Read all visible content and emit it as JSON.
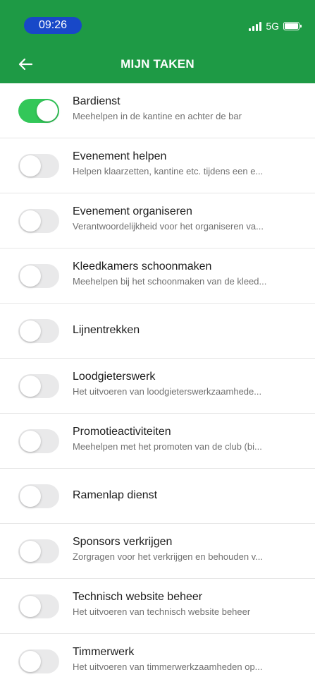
{
  "status_bar": {
    "time": "09:26",
    "network": "5G"
  },
  "nav": {
    "title": "MIJN TAKEN"
  },
  "colors": {
    "header": "#1e9a45",
    "toggle_on": "#33c759",
    "toggle_off": "#e9e9ea",
    "time_pill": "#1848c8"
  },
  "tasks": [
    {
      "title": "Bardienst",
      "desc": "Meehelpen in de kantine en achter de bar",
      "on": true
    },
    {
      "title": "Evenement helpen",
      "desc": "Helpen klaarzetten, kantine etc. tijdens een e...",
      "on": false
    },
    {
      "title": "Evenement organiseren",
      "desc": "Verantwoordelijkheid voor het organiseren va...",
      "on": false
    },
    {
      "title": "Kleedkamers schoonmaken",
      "desc": "Meehelpen bij het schoonmaken van de kleed...",
      "on": false
    },
    {
      "title": "Lijnentrekken",
      "desc": "",
      "on": false
    },
    {
      "title": "Loodgieterswerk",
      "desc": "Het uitvoeren van loodgieterswerkzaamhede...",
      "on": false
    },
    {
      "title": "Promotieactiviteiten",
      "desc": "Meehelpen met het promoten van de club (bi...",
      "on": false
    },
    {
      "title": "Ramenlap dienst",
      "desc": "",
      "on": false
    },
    {
      "title": "Sponsors verkrijgen",
      "desc": "Zorgragen voor het verkrijgen en behouden v...",
      "on": false
    },
    {
      "title": "Technisch website beheer",
      "desc": "Het uitvoeren van technisch website beheer",
      "on": false
    },
    {
      "title": "Timmerwerk",
      "desc": "Het uitvoeren van timmerwerkzaamheden op...",
      "on": false
    }
  ]
}
